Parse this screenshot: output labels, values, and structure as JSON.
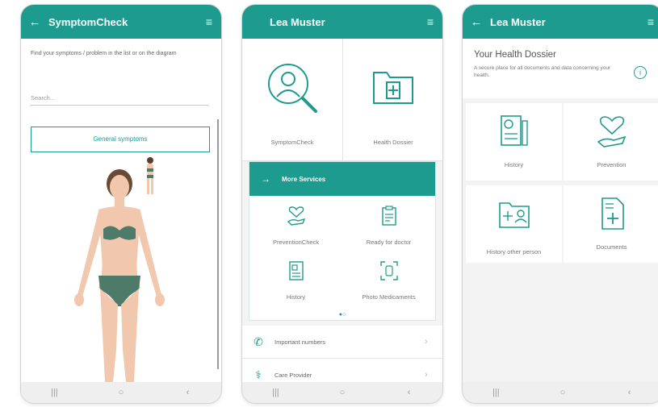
{
  "phones": [
    {
      "appbar": {
        "back": "←",
        "title": "SymptomCheck",
        "menu": "≡"
      },
      "hint": "Find your symptoms / problem in the list or on the diagram",
      "search_placeholder": "Search...",
      "general_button": "General symptoms",
      "navbar": [
        "|||",
        "○",
        "‹"
      ]
    },
    {
      "appbar": {
        "title": "Lea Muster",
        "menu": "≡"
      },
      "tiles": [
        {
          "label": "SymptomCheck",
          "icon": "search-person-icon"
        },
        {
          "label": "Health Dossier",
          "icon": "folder-plus-icon"
        }
      ],
      "more_services": {
        "header": "More Services",
        "arrow": "→",
        "items": [
          {
            "label": "PreventionCheck",
            "icon": "heart-hand-icon"
          },
          {
            "label": "Ready for doctor",
            "icon": "clipboard-icon"
          },
          {
            "label": "History",
            "icon": "document-icon"
          },
          {
            "label": "Photo Medicaments",
            "icon": "scan-icon"
          }
        ],
        "dots": "●○"
      },
      "rows": [
        {
          "label": "Important numbers",
          "icon": "phone-icon"
        },
        {
          "label": "Care Provider",
          "icon": "stethoscope-icon"
        }
      ],
      "navbar": [
        "|||",
        "○",
        "‹"
      ]
    },
    {
      "appbar": {
        "back": "←",
        "title": "Lea Muster",
        "menu": "≡"
      },
      "dossier_title": "Your Health Dossier",
      "dossier_sub": "A secure place for all documents and data concerning your health.",
      "info": "i",
      "tiles": [
        {
          "label": "History",
          "icon": "history-doc-icon"
        },
        {
          "label": "Prevention",
          "icon": "heart-hand-icon"
        },
        {
          "label": "History other person",
          "icon": "folder-person-icon"
        },
        {
          "label": "Documents",
          "icon": "document-plus-icon"
        }
      ],
      "navbar": [
        "|||",
        "○",
        "‹"
      ]
    }
  ],
  "colors": {
    "accent": "#1e9b8f",
    "skin": "#f1c7ae",
    "clothes": "#4e7a6a"
  }
}
